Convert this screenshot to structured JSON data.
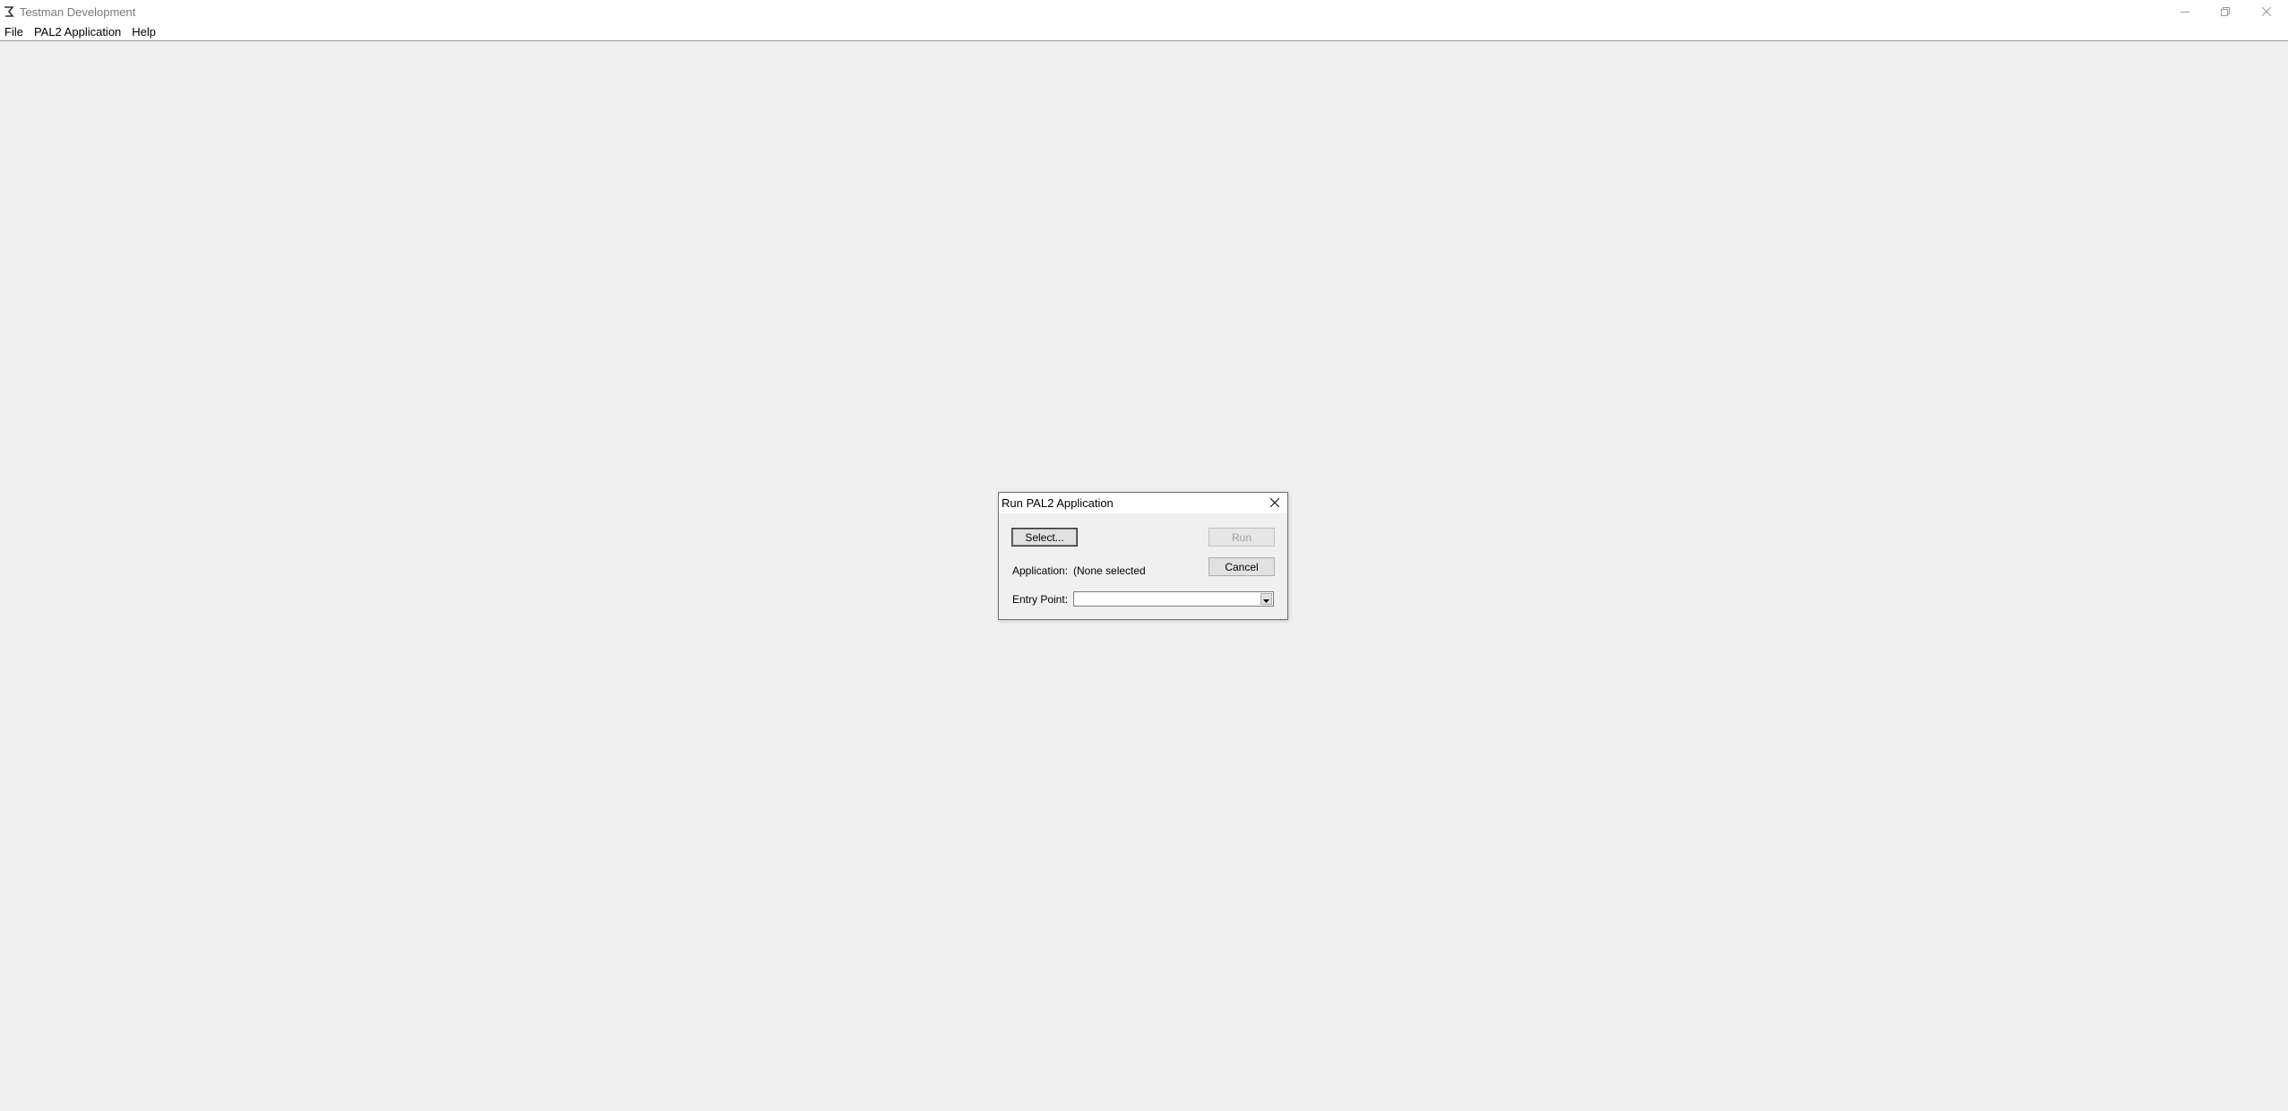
{
  "window": {
    "title": "Testman Development",
    "icons": {
      "app": "app-icon",
      "minimize": "minimize-icon",
      "restore": "restore-icon",
      "close": "close-icon"
    }
  },
  "menubar": {
    "items": [
      {
        "label": "File"
      },
      {
        "label": "PAL2 Application"
      },
      {
        "label": "Help"
      }
    ]
  },
  "dialog": {
    "title": "Run PAL2 Application",
    "select_label": "Select...",
    "run_label": "Run",
    "cancel_label": "Cancel",
    "application_label": "Application:",
    "application_value": "(None selected",
    "entry_point_label": "Entry Point:",
    "entry_point_value": "",
    "run_enabled": false
  },
  "colors": {
    "background": "#f0f0f0",
    "titlebar": "#ffffff",
    "title_text_inactive": "#7a7a7a",
    "button_face": "#e1e1e1",
    "disabled_text": "#a0a0a0"
  }
}
